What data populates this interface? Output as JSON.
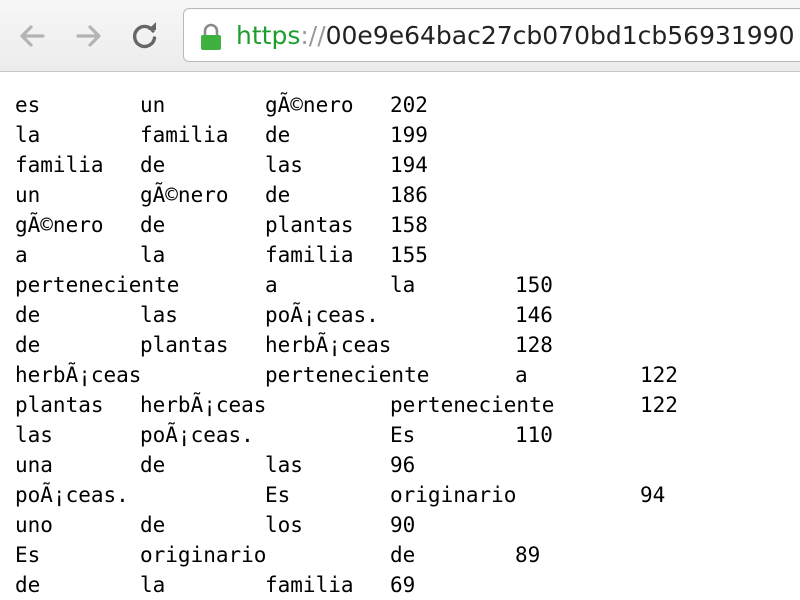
{
  "browser": {
    "back_icon": "arrow-left-icon",
    "forward_icon": "arrow-right-icon",
    "reload_icon": "reload-icon",
    "lock_icon": "lock-icon",
    "url_scheme": "https",
    "url_sep": "://",
    "url_rest": "00e9e64bac27cb070bd1cb56931990",
    "colors": {
      "scheme": "#1f9e2e",
      "lock": "#3eb13e"
    }
  },
  "rows": [
    [
      "es",
      "un",
      "gÃ©nero",
      "202"
    ],
    [
      "la",
      "familia",
      "de",
      "199"
    ],
    [
      "familia",
      "de",
      "las",
      "194"
    ],
    [
      "un",
      "gÃ©nero",
      "de",
      "186"
    ],
    [
      "gÃ©nero",
      "de",
      "plantas",
      "158"
    ],
    [
      "a",
      "la",
      "familia",
      "155"
    ],
    [
      "perteneciente",
      "",
      "a",
      "la",
      "150"
    ],
    [
      "de",
      "las",
      "poÃ¡ceas.",
      "",
      "146"
    ],
    [
      "de",
      "plantas",
      "herbÃ¡ceas",
      "",
      "128"
    ],
    [
      "herbÃ¡ceas",
      "",
      "perteneciente",
      "",
      "a",
      "122"
    ],
    [
      "plantas",
      "herbÃ¡ceas",
      "",
      "perteneciente",
      "",
      "122"
    ],
    [
      "las",
      "poÃ¡ceas.",
      "",
      "Es",
      "110"
    ],
    [
      "una",
      "de",
      "las",
      "96"
    ],
    [
      "poÃ¡ceas.",
      "",
      "Es",
      "originario",
      "",
      "94"
    ],
    [
      "uno",
      "de",
      "los",
      "90"
    ],
    [
      "Es",
      "originario",
      "",
      "de",
      "89"
    ],
    [
      "de",
      "la",
      "familia",
      "69"
    ]
  ]
}
